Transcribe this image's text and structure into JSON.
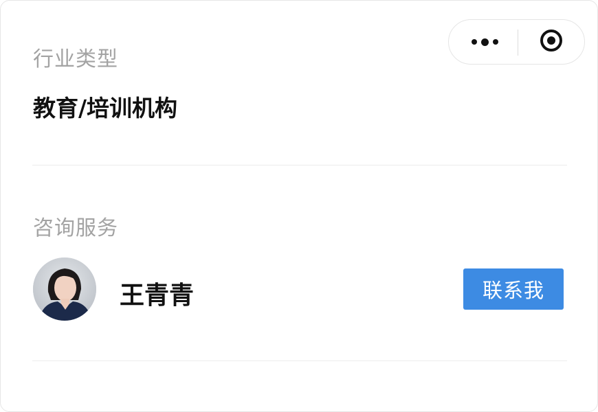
{
  "industry": {
    "label": "行业类型",
    "value": "教育/培训机构"
  },
  "consult": {
    "label": "咨询服务",
    "consultant_name": "王青青",
    "contact_button": "联系我"
  },
  "capsule": {
    "more_icon": "more-dots-icon",
    "close_icon": "target-circle-icon"
  },
  "colors": {
    "accent": "#3d8be3",
    "label_gray": "#a3a3a3",
    "text": "#111111",
    "divider": "#ececec"
  }
}
